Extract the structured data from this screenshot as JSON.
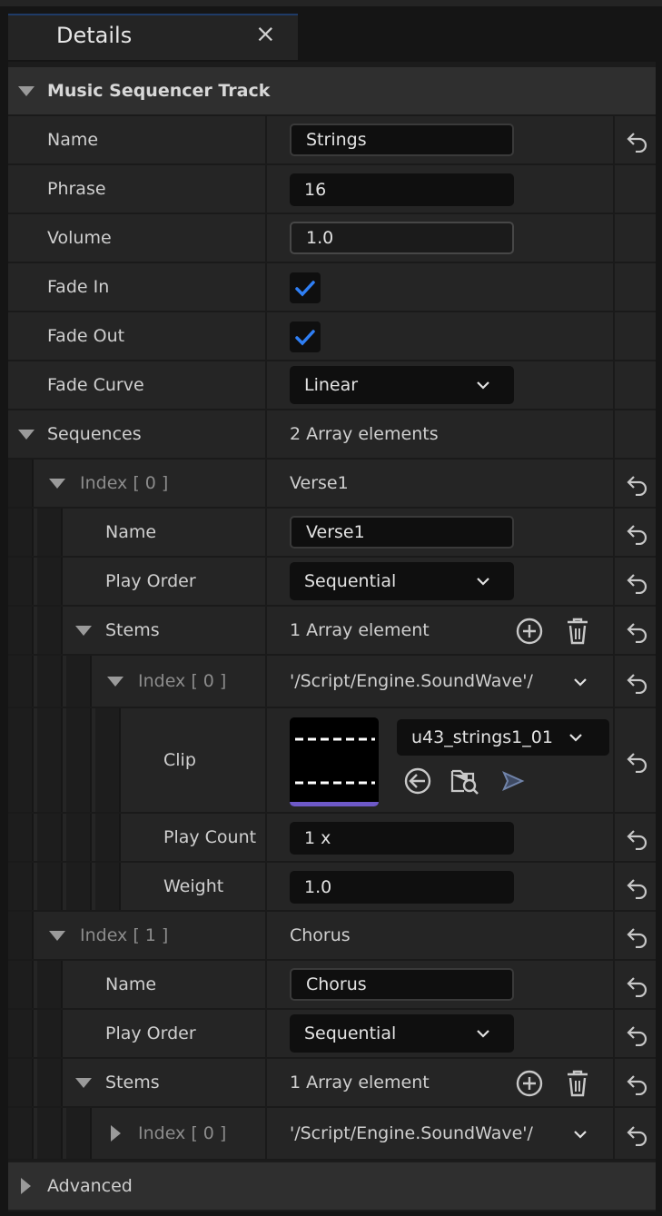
{
  "tab": {
    "title": "Details",
    "close_glyph": "×"
  },
  "category": {
    "label": "Music Sequencer Track"
  },
  "props": {
    "name": {
      "label": "Name",
      "value": "Strings"
    },
    "phrase": {
      "label": "Phrase",
      "value": "16"
    },
    "volume": {
      "label": "Volume",
      "value": "1.0"
    },
    "fade_in": {
      "label": "Fade In",
      "checked": true
    },
    "fade_out": {
      "label": "Fade Out",
      "checked": true
    },
    "fade_curve": {
      "label": "Fade Curve",
      "value": "Linear"
    }
  },
  "sequences": {
    "label": "Sequences",
    "count": "2 Array elements",
    "items": [
      {
        "index_label": "Index [ 0 ]",
        "value": "Verse1",
        "name_label": "Name",
        "name_value": "Verse1",
        "play_order_label": "Play Order",
        "play_order_value": "Sequential",
        "stems_label": "Stems",
        "stems_count": "1 Array element",
        "stem": {
          "index_label": "Index [ 0 ]",
          "value": "'/Script/Engine.SoundWave'/",
          "clip_label": "Clip",
          "clip_asset": "u43_strings1_01",
          "play_count_label": "Play Count",
          "play_count_value": "1 x",
          "weight_label": "Weight",
          "weight_value": "1.0"
        }
      },
      {
        "index_label": "Index [ 1 ]",
        "value": "Chorus",
        "name_label": "Name",
        "name_value": "Chorus",
        "play_order_label": "Play Order",
        "play_order_value": "Sequential",
        "stems_label": "Stems",
        "stems_count": "1 Array element",
        "stem": {
          "index_label": "Index [ 0 ]",
          "value": "'/Script/Engine.SoundWave'/"
        }
      }
    ]
  },
  "advanced": {
    "label": "Advanced"
  },
  "colors": {
    "accent": "#2f7ff5",
    "thumb_bar": "#6e59c8",
    "panel": "#252525",
    "category": "#2f2f2f"
  },
  "icons": [
    "close-icon",
    "reset-arrow-icon",
    "checkmark-icon",
    "chevron-down-icon",
    "add-element-icon",
    "delete-icon",
    "use-selected-asset-icon",
    "browse-asset-icon",
    "play-icon"
  ]
}
